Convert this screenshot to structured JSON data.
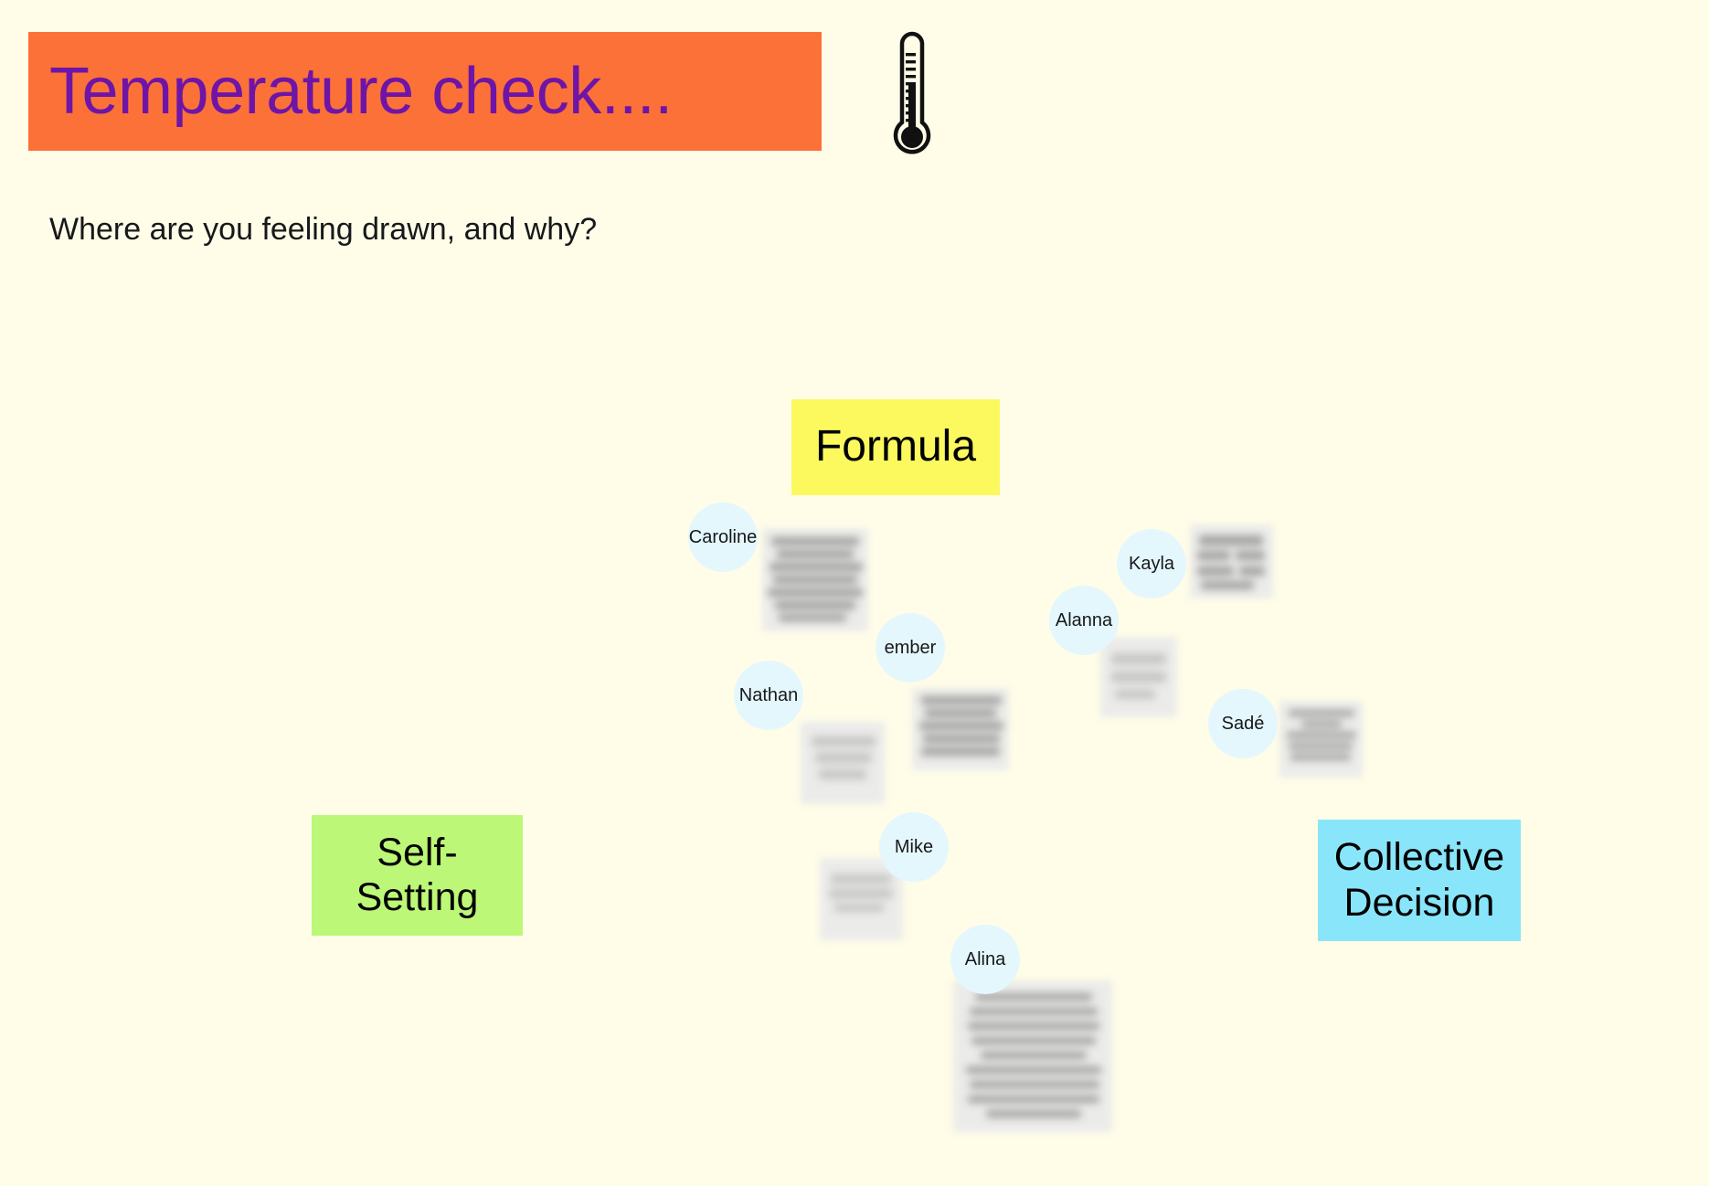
{
  "board": {
    "background_color": "#FFFDE8"
  },
  "header": {
    "title": "Temperature check....",
    "banner_color": "#FC7138",
    "title_color": "#6E15A8",
    "icon": "thermometer-icon"
  },
  "prompt": {
    "text": "Where are you feeling drawn, and why?"
  },
  "categories": [
    {
      "id": "formula",
      "label": "Formula",
      "lines": [
        "Formula"
      ],
      "color": "#FCF95F"
    },
    {
      "id": "self-setting",
      "label": "Self-Setting",
      "lines": [
        "Self-",
        "Setting"
      ],
      "color": "#BDF777"
    },
    {
      "id": "collective-decision",
      "label": "Collective Decision",
      "lines": [
        "Collective",
        "Decision"
      ],
      "color": "#89E6FA"
    }
  ],
  "participants": [
    {
      "name": "Caroline",
      "color": "#E4F7FD"
    },
    {
      "name": "Kayla",
      "color": "#E4F7FD"
    },
    {
      "name": "Alanna",
      "color": "#E4F7FD"
    },
    {
      "name": "ember",
      "color": "#E4F7FD"
    },
    {
      "name": "Nathan",
      "color": "#E4F7FD"
    },
    {
      "name": "Sadé",
      "color": "#E4F7FD"
    },
    {
      "name": "Mike",
      "color": "#E4F7FD"
    },
    {
      "name": "Alina",
      "color": "#E4F7FD"
    }
  ],
  "contribution_notes": [
    {
      "owner": "Caroline",
      "content": "",
      "redacted": true
    },
    {
      "owner": "Kayla",
      "content": "",
      "redacted": true
    },
    {
      "owner": "Alanna",
      "content": "",
      "redacted": true
    },
    {
      "owner": "ember",
      "content": "",
      "redacted": true
    },
    {
      "owner": "Nathan",
      "content": "",
      "redacted": true
    },
    {
      "owner": "Sadé",
      "content": "",
      "redacted": true
    },
    {
      "owner": "Mike",
      "content": "",
      "redacted": true
    },
    {
      "owner": "Alina",
      "content": "",
      "redacted": true
    }
  ]
}
